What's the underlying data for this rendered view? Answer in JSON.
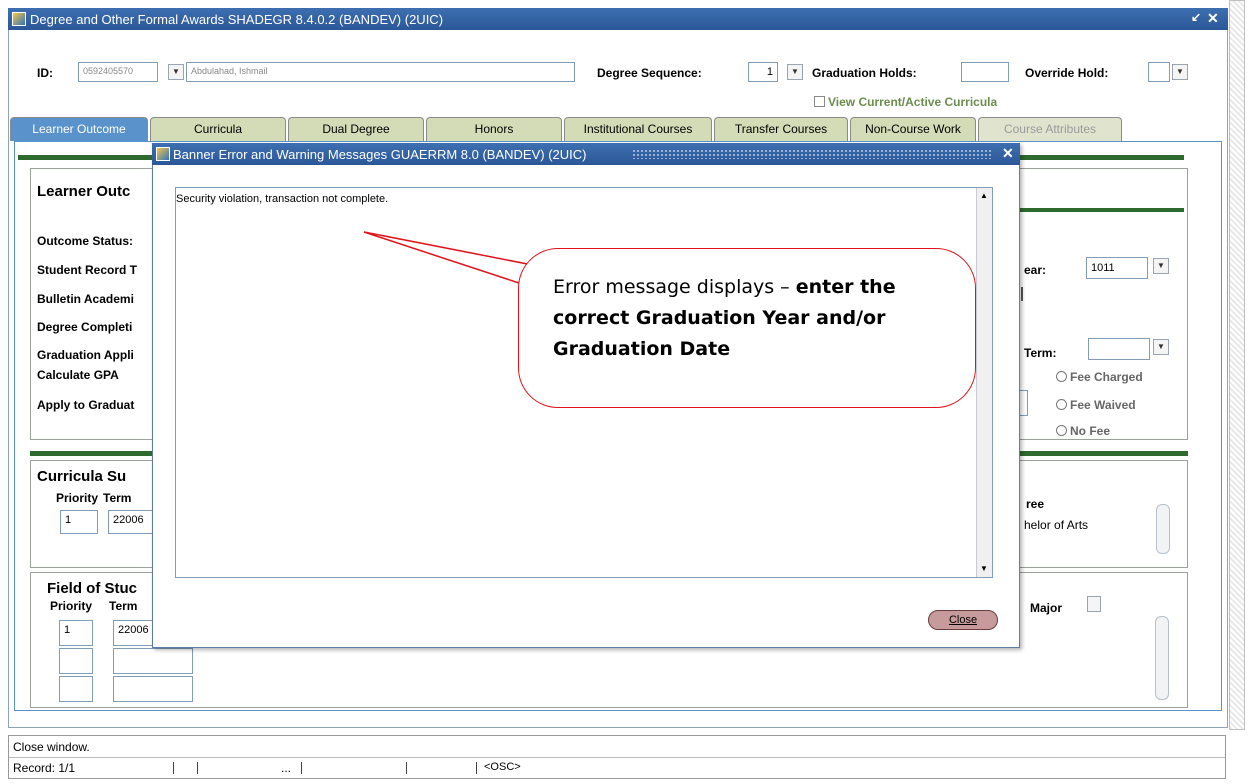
{
  "window": {
    "title": "Degree and Other Formal Awards  SHADEGR  8.4.0.2  (BANDEV)  (2UIC)"
  },
  "header": {
    "id_label": "ID:",
    "id_value": "0592405570",
    "name_value": "Abdulahad, Ishmail",
    "degree_sequence_label": "Degree Sequence:",
    "degree_sequence_value": "1",
    "graduation_holds_label": "Graduation Holds:",
    "graduation_holds_value": "",
    "override_hold_label": "Override Hold:",
    "override_hold_value": "",
    "view_current_label": "View Current/Active Curricula"
  },
  "tabs": [
    {
      "label": "Learner Outcome",
      "state": "active"
    },
    {
      "label": "Curricula",
      "state": "normal"
    },
    {
      "label": "Dual Degree",
      "state": "normal"
    },
    {
      "label": "Honors",
      "state": "normal"
    },
    {
      "label": "Institutional Courses",
      "state": "normal"
    },
    {
      "label": "Transfer Courses",
      "state": "normal"
    },
    {
      "label": "Non-Course Work",
      "state": "normal"
    },
    {
      "label": "Course Attributes",
      "state": "disabled"
    }
  ],
  "learner": {
    "heading": "Learner Outc",
    "outcome_status": "Outcome Status:",
    "student_record": "Student Record T",
    "bulletin": "Bulletin Academi",
    "degree_completion": "Degree Completi",
    "graduation_appl": "Graduation Appli",
    "calculate_gpa": "Calculate GPA",
    "apply_to_graduate": "Apply to Graduat",
    "year_label": "ear:",
    "year_value": "1011",
    "term_label": "Term:",
    "term_value": "",
    "fee_charged": "Fee Charged",
    "fee_waived": "Fee Waived",
    "no_fee": "No Fee"
  },
  "curricula": {
    "heading": "Curricula Su",
    "priority_label": "Priority",
    "term_label": "Term",
    "priority_value": "1",
    "term_value": "22006",
    "degree_label": "ree",
    "degree_value": "helor of Arts"
  },
  "field_of_study": {
    "heading": "Field of Stuc",
    "priority_label": "Priority",
    "term_label": "Term",
    "priority_value": "1",
    "term_value": "22006",
    "major_label": "Major"
  },
  "dialog": {
    "title": "Banner Error and Warning Messages  GUAERRM  8.0  (BANDEV)  (2UIC)",
    "message": "Security violation, transaction not complete.",
    "close_label": "Close"
  },
  "callout": {
    "text_plain": "Error message displays – ",
    "text_bold": "enter the correct Graduation Year and/or Graduation Date"
  },
  "statusbar": {
    "message": "Close window.",
    "record": "Record: 1/1",
    "ellipsis": "...",
    "osc": "<OSC>"
  },
  "colors": {
    "accent": "#5a93cb",
    "titlebar": "#2b5797",
    "green_rule": "#2e6a2e",
    "callout_border": "#e0121a"
  }
}
